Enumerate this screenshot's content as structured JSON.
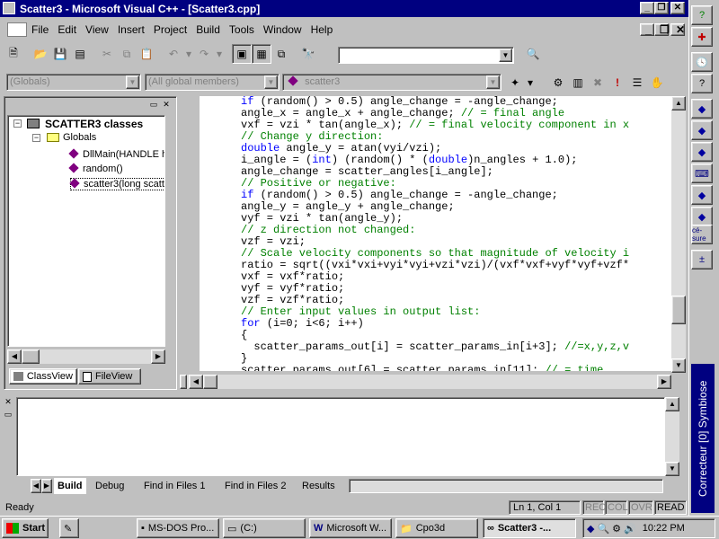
{
  "window": {
    "title": "Scatter3 - Microsoft Visual C++ - [Scatter3.cpp]"
  },
  "menu": [
    "File",
    "Edit",
    "View",
    "Insert",
    "Project",
    "Build",
    "Tools",
    "Window",
    "Help"
  ],
  "combos": {
    "globals": "(Globals)",
    "members": "(All global members)",
    "function": "scatter3",
    "find": ""
  },
  "tree": {
    "root": "SCATTER3 classes",
    "folder": "Globals",
    "items": [
      "DllMain(HANDLE h",
      "random()",
      "scatter3(long scatte"
    ]
  },
  "tree_tabs": [
    "ClassView",
    "FileView"
  ],
  "code_lines": [
    {
      "k": "n",
      "t": "if (random() > 0.5) angle_change = -angle_change;"
    },
    {
      "k": "n",
      "t": "angle_x = angle_x + angle_change; // = final angle"
    },
    {
      "k": "n",
      "t": "vxf = vzi * tan(angle_x); // = final velocity component in x"
    },
    {
      "k": "c",
      "t": "// Change y direction:"
    },
    {
      "k": "n",
      "t": "double angle_y = atan(vyi/vzi);"
    },
    {
      "k": "n",
      "t": "i_angle = (int) (random() * (double)n_angles + 1.0);"
    },
    {
      "k": "n",
      "t": "angle_change = scatter_angles[i_angle];"
    },
    {
      "k": "c",
      "t": "// Positive or negative:"
    },
    {
      "k": "n",
      "t": "if (random() > 0.5) angle_change = -angle_change;"
    },
    {
      "k": "n",
      "t": "angle_y = angle_y + angle_change;"
    },
    {
      "k": "n",
      "t": "vyf = vzi * tan(angle_y);"
    },
    {
      "k": "c",
      "t": "// z direction not changed:"
    },
    {
      "k": "n",
      "t": "vzf = vzi;"
    },
    {
      "k": "c",
      "t": "// Scale velocity components so that magnitude of velocity i"
    },
    {
      "k": "n",
      "t": "ratio = sqrt((vxi*vxi+vyi*vyi+vzi*vzi)/(vxf*vxf+vyf*vyf+vzf*"
    },
    {
      "k": "n",
      "t": "vxf = vxf*ratio;"
    },
    {
      "k": "n",
      "t": "vyf = vyf*ratio;"
    },
    {
      "k": "n",
      "t": "vzf = vzf*ratio;"
    },
    {
      "k": "c",
      "t": "// Enter input values in output list:"
    },
    {
      "k": "n",
      "t": "for (i=0; i<6; i++)"
    },
    {
      "k": "n",
      "t": "{"
    },
    {
      "k": "n",
      "t": "  scatter_params_out[i] = scatter_params_in[i+3]; //=x,y,z,v"
    },
    {
      "k": "n",
      "t": "}"
    },
    {
      "k": "n",
      "t": "scatter_params_out[6] = scatter_params_in[11]; // = time"
    }
  ],
  "output_tabs": [
    "Build",
    "Debug",
    "Find in Files 1",
    "Find in Files 2",
    "Results"
  ],
  "status": {
    "text": "Ready",
    "position": "Ln 1, Col 1",
    "indicators": [
      "REC",
      "COL",
      "OVR",
      "READ"
    ]
  },
  "taskbar": {
    "start": "Start",
    "tasks": [
      "MS-DOS Pro...",
      "(C:)",
      "Microsoft W...",
      "Cpo3d",
      "Scatter3 -..."
    ],
    "clock": "10:22 PM"
  },
  "side_banner": "Correcteur [0] Symbiose",
  "side_label": "cé-sure"
}
